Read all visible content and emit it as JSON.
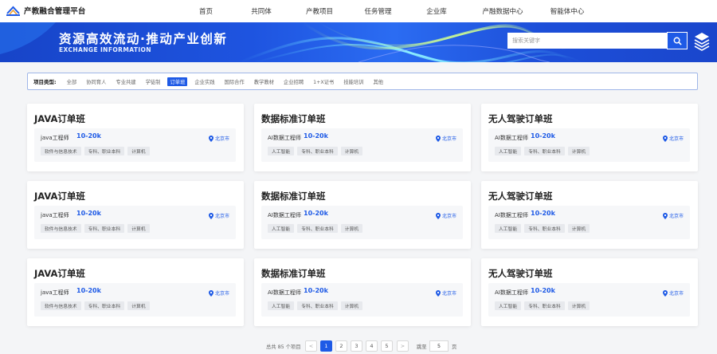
{
  "brand": {
    "name": "产教融合管理平台"
  },
  "nav": [
    {
      "label": "首页"
    },
    {
      "label": "共同体"
    },
    {
      "label": "产教项目"
    },
    {
      "label": "任务管理"
    },
    {
      "label": "企业库"
    },
    {
      "label": "产融数据中心"
    },
    {
      "label": "智能体中心"
    }
  ],
  "banner": {
    "title": "资源高效流动·推动产业创新",
    "subtitle": "EXCHANGE INFORMATION",
    "search_placeholder": "搜索关键字"
  },
  "filter": {
    "label": "项目类型:",
    "options": [
      {
        "label": "全部"
      },
      {
        "label": "协同育人"
      },
      {
        "label": "专业共建"
      },
      {
        "label": "学徒制"
      },
      {
        "label": "订单班",
        "active": true
      },
      {
        "label": "企业实践"
      },
      {
        "label": "国际合作"
      },
      {
        "label": "教学教材"
      },
      {
        "label": "企业招聘"
      },
      {
        "label": "1+X证书"
      },
      {
        "label": "技能培训"
      },
      {
        "label": "其他"
      }
    ]
  },
  "cards": [
    {
      "title": "JAVA订单班",
      "job": "java工程师",
      "salary": "10-20k",
      "location": "北京市",
      "tags": [
        "软件与信息技术",
        "专科、职业本科",
        "计算机"
      ]
    },
    {
      "title": "数据标准订单班",
      "job": "AI数据工程师",
      "salary": "10-20k",
      "location": "北京市",
      "tags": [
        "人工智能",
        "专科、职业本科",
        "计算机"
      ]
    },
    {
      "title": "无人驾驶订单班",
      "job": "AI数据工程师",
      "salary": "10-20k",
      "location": "北京市",
      "tags": [
        "人工智能",
        "专科、职业本科",
        "计算机"
      ]
    },
    {
      "title": "JAVA订单班",
      "job": "java工程师",
      "salary": "10-20k",
      "location": "北京市",
      "tags": [
        "软件与信息技术",
        "专科、职业本科",
        "计算机"
      ]
    },
    {
      "title": "数据标准订单班",
      "job": "AI数据工程师",
      "salary": "10-20k",
      "location": "北京市",
      "tags": [
        "人工智能",
        "专科、职业本科",
        "计算机"
      ]
    },
    {
      "title": "无人驾驶订单班",
      "job": "AI数据工程师",
      "salary": "10-20k",
      "location": "北京市",
      "tags": [
        "人工智能",
        "专科、职业本科",
        "计算机"
      ]
    },
    {
      "title": "JAVA订单班",
      "job": "java工程师",
      "salary": "10-20k",
      "location": "北京市",
      "tags": [
        "软件与信息技术",
        "专科、职业本科",
        "计算机"
      ]
    },
    {
      "title": "数据标准订单班",
      "job": "AI数据工程师",
      "salary": "10-20k",
      "location": "北京市",
      "tags": [
        "人工智能",
        "专科、职业本科",
        "计算机"
      ]
    },
    {
      "title": "无人驾驶订单班",
      "job": "AI数据工程师",
      "salary": "10-20k",
      "location": "北京市",
      "tags": [
        "人工智能",
        "专科、职业本科",
        "计算机"
      ]
    }
  ],
  "pagination": {
    "total_text": "总共 85 个项目",
    "prev": "<",
    "pages": [
      "1",
      "2",
      "3",
      "4",
      "5"
    ],
    "current": "1",
    "next": ">",
    "goto_label": "跳至",
    "goto_value": "5",
    "page_unit": "页"
  },
  "colors": {
    "accent": "#1e5ae6"
  }
}
